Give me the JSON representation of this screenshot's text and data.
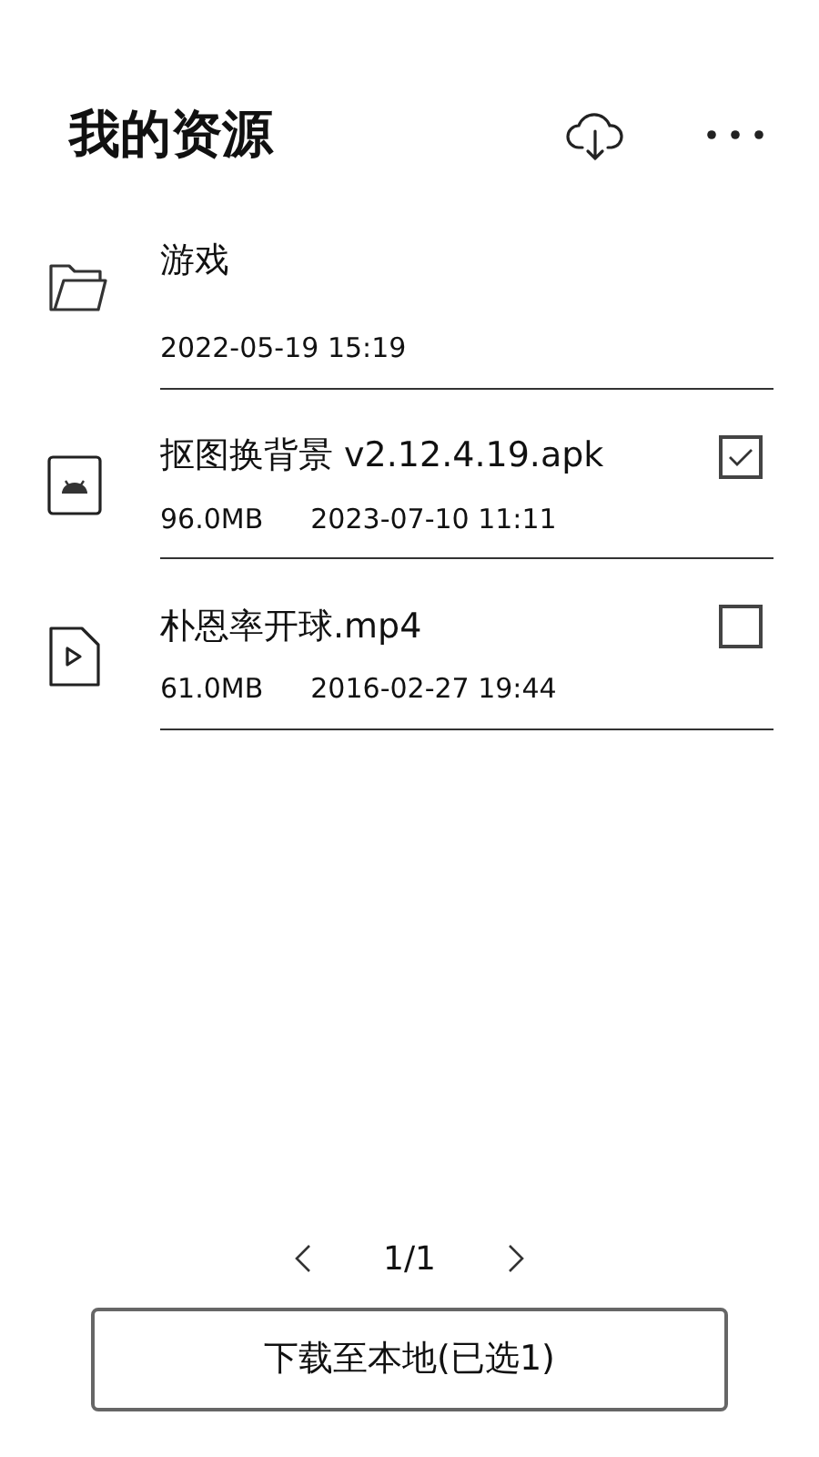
{
  "header": {
    "title": "我的资源"
  },
  "items": [
    {
      "kind": "folder",
      "name": "游戏",
      "date": "2022-05-19 15:19"
    },
    {
      "kind": "apk",
      "name": "抠图换背景 v2.12.4.19.apk",
      "size": "96.0MB",
      "date": "2023-07-10 11:11",
      "checked": true
    },
    {
      "kind": "video",
      "name": "朴恩率开球.mp4",
      "size": "61.0MB",
      "date": "2016-02-27 19:44",
      "checked": false
    }
  ],
  "pager": {
    "page": "1/1"
  },
  "download_button": "下载至本地(已选1)"
}
